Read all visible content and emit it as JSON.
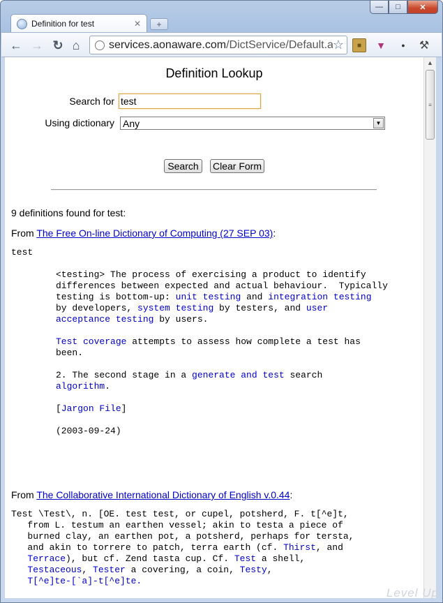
{
  "browser": {
    "tab_title": "Definition for test",
    "new_tab": "+",
    "url_host": "services.aonaware.com",
    "url_path": "/DictService/Default.aspx"
  },
  "form": {
    "heading": "Definition Lookup",
    "search_label": "Search for",
    "search_value": "test",
    "dictionary_label": "Using dictionary",
    "dictionary_value": "Any",
    "search_button": "Search",
    "clear_button": "Clear Form"
  },
  "results": {
    "summary": "9 definitions found for test:",
    "foldoc": {
      "from": "From ",
      "source": "The Free On-line Dictionary of Computing (27 SEP 03)",
      "after": ":",
      "headword": "test",
      "l1": "<testing> The process of exercising a product to identify",
      "l2": "differences between expected and actual behaviour.  Typically",
      "l3a": "testing is bottom-up: ",
      "l3k1": "unit testing",
      "l3b": " and ",
      "l3k2": "integration testing",
      "l4a": "by developers, ",
      "l4k1": "system testing",
      "l4b": " by testers, and ",
      "l4k2": "user",
      "l5k": "acceptance testing",
      "l5b": " by users.",
      "l6k": "Test coverage",
      "l6b": " attempts to assess how complete a test has",
      "l7": "been.",
      "l8a": "2. The second stage in a ",
      "l8k": "generate and test",
      "l8b": " search",
      "l9k": "algorithm",
      "l9b": ".",
      "l10a": "[",
      "l10k": "Jargon File",
      "l10b": "]",
      "l11": "(2003-09-24)"
    },
    "gcide": {
      "from": "From ",
      "source": "The Collaborative International Dictionary of English v.0.44",
      "after": ":",
      "g1": "Test \\Test\\, n. [OE. test test, or cupel, potsherd, F. t[^e]t,",
      "g2": "   from L. testum an earthen vessel; akin to testa a piece of",
      "g3": "   burned clay, an earthen pot, a potsherd, perhaps for tersta,",
      "g4a": "   and akin to torrere to patch, terra earth (cf. ",
      "g4k": "Thirst",
      "g4b": ", and",
      "g5a": "   ",
      "g5k1": "Terrace",
      "g5b": "), but cf. Zend tasta cup. Cf. ",
      "g5k2": "Test",
      "g5c": " a shell,",
      "g6a": "   ",
      "g6k1": "Testaceous",
      "g6b": ", ",
      "g6k2": "Tester",
      "g6c": " a covering, a coin, ",
      "g6k3": "Testy",
      "g6d": ",",
      "g7": "   T[^e]te-[`a]-t[^e]te."
    }
  },
  "watermark": "Level Up"
}
